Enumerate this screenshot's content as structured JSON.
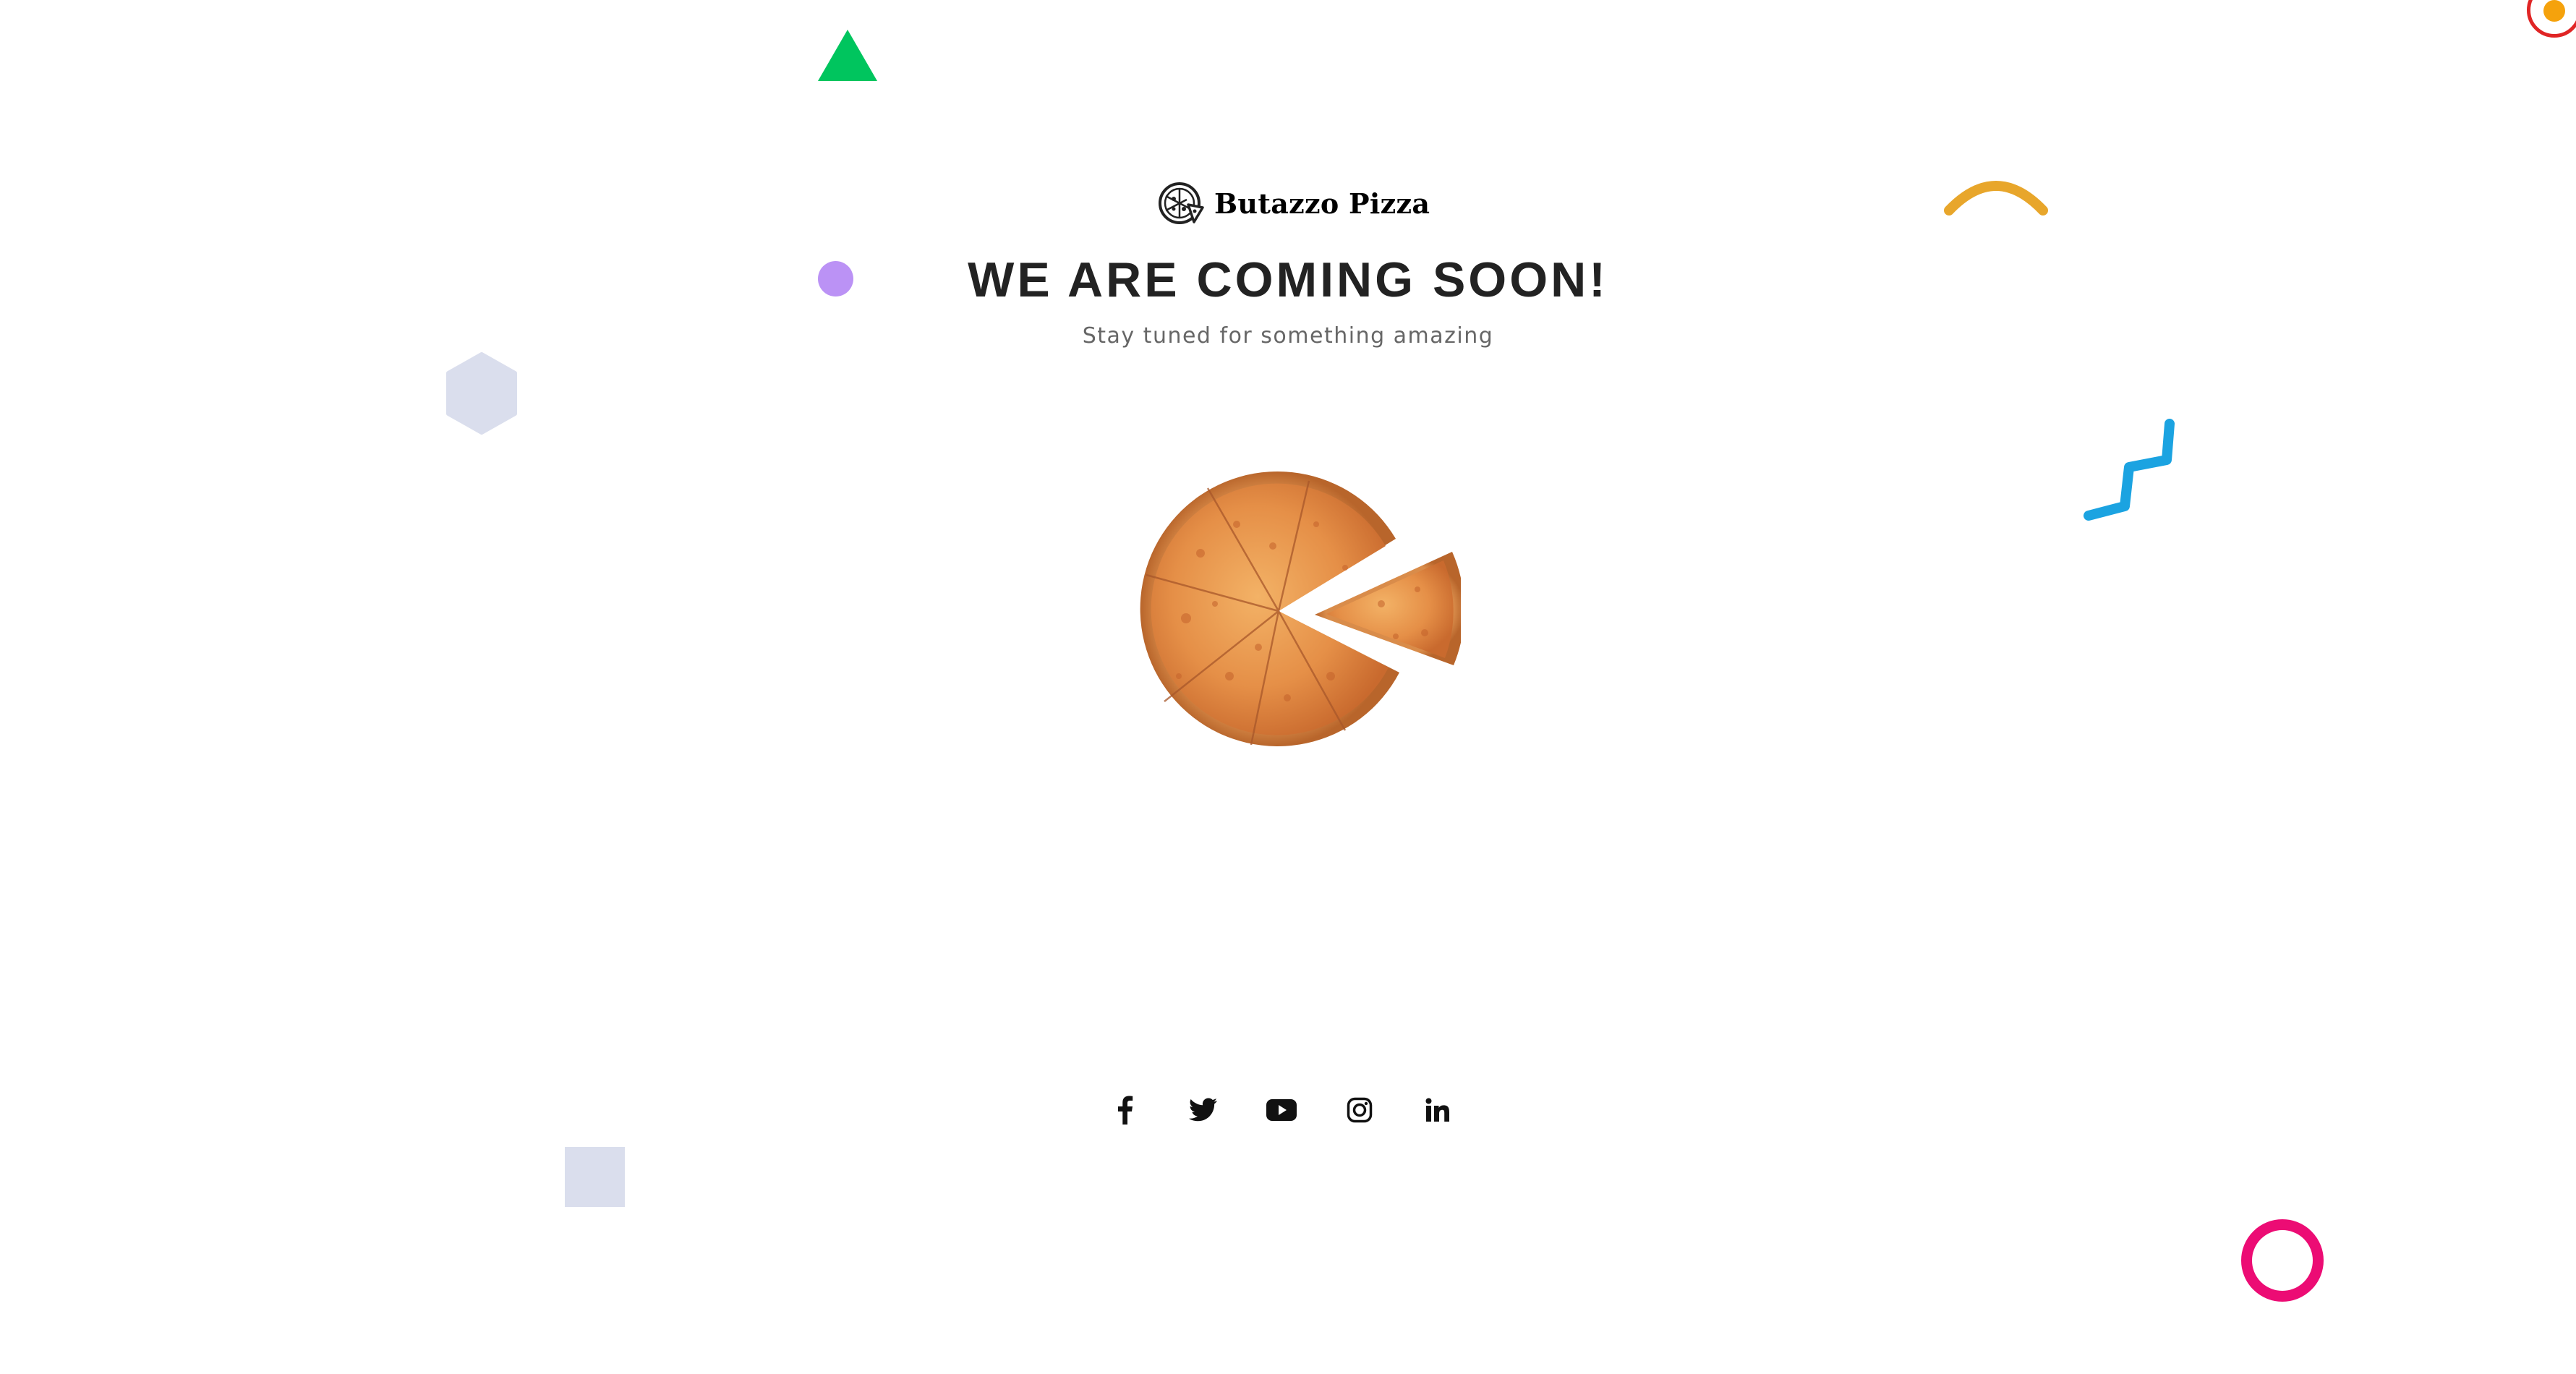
{
  "brand": {
    "name": "Butazzo Pizza",
    "logo_icon": "pizza-logo-icon"
  },
  "hero": {
    "headline": "WE ARE COMING SOON!",
    "tagline": "Stay tuned for something amazing",
    "image": "pizza-with-slice-image"
  },
  "social": [
    {
      "name": "facebook",
      "icon": "facebook-icon"
    },
    {
      "name": "twitter",
      "icon": "twitter-icon"
    },
    {
      "name": "youtube",
      "icon": "youtube-icon"
    },
    {
      "name": "instagram",
      "icon": "instagram-icon"
    },
    {
      "name": "linkedin",
      "icon": "linkedin-icon"
    }
  ],
  "decorations": {
    "triangle_color": "#00c55e",
    "dot_color": "#bb92f5",
    "hexagon_color": "#dadeed",
    "square_color": "#dadeed",
    "arc_color": "#e8a62b",
    "zigzag_color": "#1ba3e1",
    "ring_color": "#ec0c74"
  }
}
